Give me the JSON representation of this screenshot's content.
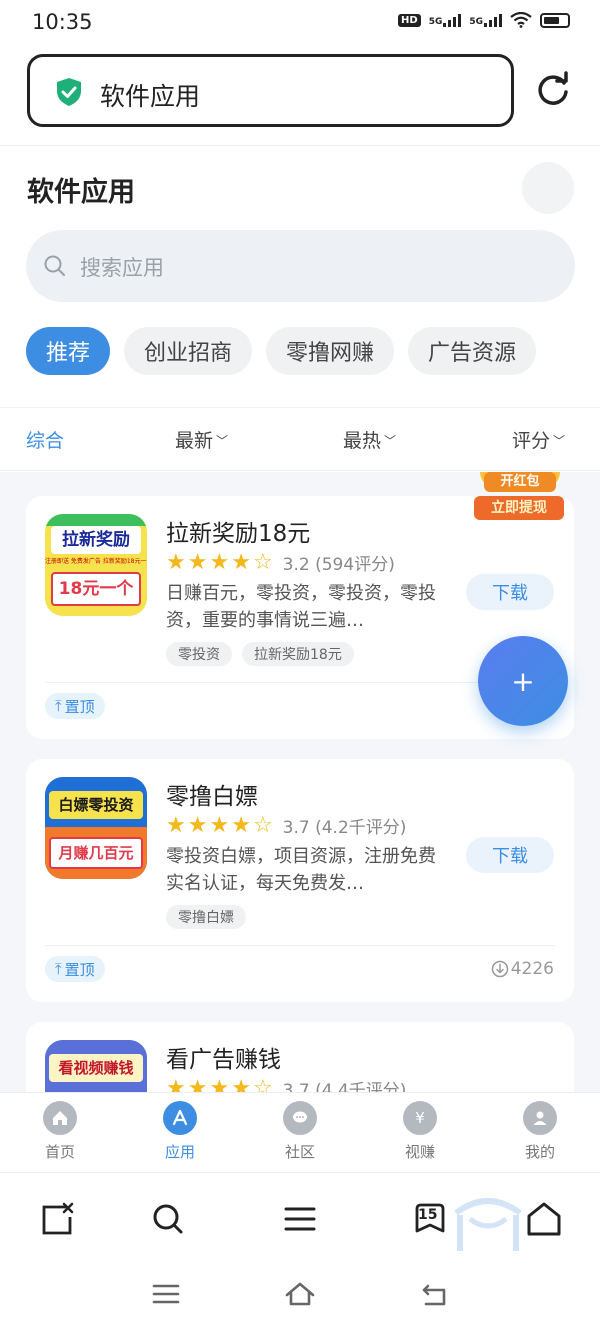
{
  "status_bar": {
    "time": "10:35",
    "hd_label": "HD",
    "signal_label_1": "5G",
    "signal_label_2": "5G"
  },
  "address_bar": {
    "title": "软件应用",
    "secure_icon": "shield-check-icon",
    "refresh_icon": "refresh-icon"
  },
  "page": {
    "title": "软件应用"
  },
  "search": {
    "placeholder": "搜索应用"
  },
  "categories": [
    {
      "label": "推荐",
      "active": true
    },
    {
      "label": "创业招商",
      "active": false
    },
    {
      "label": "零撸网赚",
      "active": false
    },
    {
      "label": "广告资源",
      "active": false
    }
  ],
  "sort": {
    "items": [
      {
        "label": "综合",
        "active": true,
        "caret": ""
      },
      {
        "label": "最新",
        "active": false,
        "caret": "﹀"
      },
      {
        "label": "最热",
        "active": false,
        "caret": "﹀"
      },
      {
        "label": "评分",
        "active": false,
        "caret": "﹀"
      }
    ]
  },
  "apps": [
    {
      "name": "拉新奖励18元",
      "icon_text_top": "拉新奖励",
      "icon_text_mid": "注册即送 免费发广告 拉新奖励18元一个",
      "icon_text_bottom": "18元一个",
      "rating_value": 3.2,
      "rating_text": "3.2 (594评分)",
      "description": "日赚百元，零投资，零投资，零投资，重要的事情说三遍…",
      "tags": [
        "零投资",
        "拉新奖励18元"
      ],
      "download_label": "下载",
      "pin_label": "置顶",
      "download_count": ""
    },
    {
      "name": "零撸白嫖",
      "icon_text_top": "白嫖零投资",
      "icon_text_mid": "",
      "icon_text_bottom": "月赚几百元",
      "rating_value": 3.7,
      "rating_text": "3.7 (4.2千评分)",
      "description": "零投资白嫖，项目资源，注册免费实名认证，每天免费发…",
      "tags": [
        "零撸白嫖"
      ],
      "download_label": "下载",
      "pin_label": "置顶",
      "download_count": "4226"
    },
    {
      "name": "看广告赚钱",
      "icon_text_top": "看视频赚钱",
      "icon_text_mid": "",
      "icon_text_bottom": "",
      "rating_value": 3.7,
      "rating_text": "3.7 (4.4千评分)",
      "description": "",
      "tags": [],
      "download_label": "",
      "pin_label": "",
      "download_count": ""
    }
  ],
  "floating": {
    "fab_label": "+",
    "redpack_top": "开红包",
    "redpack_bottom": "立即提现"
  },
  "tabbar": [
    {
      "label": "首页",
      "icon": "home-icon",
      "active": false
    },
    {
      "label": "应用",
      "icon": "app-store-icon",
      "active": true
    },
    {
      "label": "社区",
      "icon": "chat-icon",
      "active": false
    },
    {
      "label": "视赚",
      "icon": "yen-icon",
      "active": false
    },
    {
      "label": "我的",
      "icon": "user-icon",
      "active": false
    }
  ],
  "browser_toolbar": {
    "tab_count": "15"
  },
  "colors": {
    "accent": "#3d8ee2",
    "star": "#f3b81b",
    "shield": "#1fb07a"
  }
}
